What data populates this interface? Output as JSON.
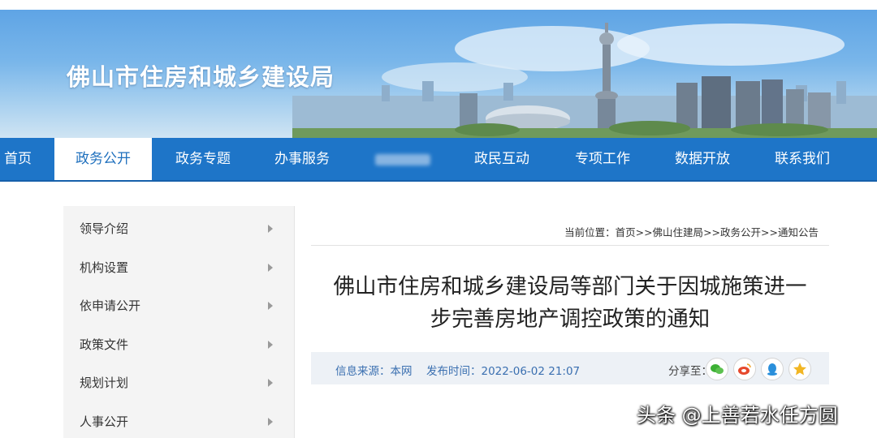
{
  "site": {
    "title": "佛山市住房和城乡建设局"
  },
  "nav": {
    "items": [
      {
        "label": "首页"
      },
      {
        "label": "政务公开",
        "active": true
      },
      {
        "label": "政务专题"
      },
      {
        "label": "办事服务"
      },
      {
        "label": "",
        "blurred": true
      },
      {
        "label": "政民互动"
      },
      {
        "label": "专项工作"
      },
      {
        "label": "数据开放"
      },
      {
        "label": "联系我们"
      }
    ]
  },
  "sidebar": {
    "items": [
      {
        "label": "领导介绍"
      },
      {
        "label": "机构设置"
      },
      {
        "label": "依申请公开"
      },
      {
        "label": "政策文件"
      },
      {
        "label": "规划计划"
      },
      {
        "label": "人事公开"
      }
    ]
  },
  "breadcrumb": {
    "prefix": "当前位置：",
    "items": [
      "首页",
      "佛山住建局",
      "政务公开",
      "通知公告"
    ],
    "separator": ">>"
  },
  "article": {
    "title_line1": "佛山市住房和城乡建设局等部门关于因城施策进一",
    "title_line2": "步完善房地产调控政策的通知",
    "source_label": "信息来源：本网",
    "publish_label": "发布时间：2022-06-02 21:07",
    "share_label": "分享至："
  },
  "share_icons": [
    "wechat-icon",
    "weibo-icon",
    "qq-icon",
    "qzone-star-icon"
  ],
  "colors": {
    "nav_bg": "#1e75c8",
    "nav_active_text": "#1e6fbd",
    "info_text": "#3a6fb0",
    "wechat": "#3cb034",
    "weibo": "#e6492d",
    "qq": "#2a8fdb",
    "star": "#f2b623"
  },
  "watermark": "头条 @上善若水任方圆"
}
